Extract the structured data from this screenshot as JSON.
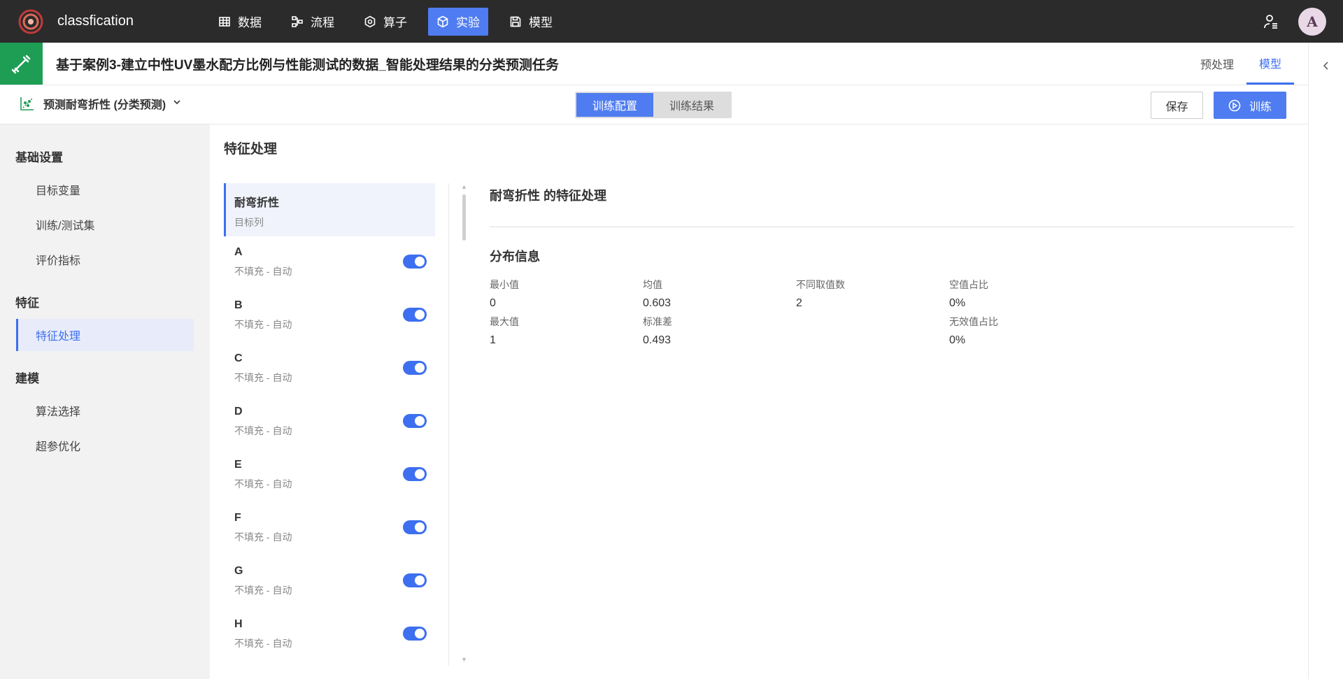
{
  "app": {
    "name": "classfication"
  },
  "nav": [
    {
      "label": "数据",
      "icon": "table-icon",
      "active": false
    },
    {
      "label": "流程",
      "icon": "flow-icon",
      "active": false
    },
    {
      "label": "算子",
      "icon": "hexagon-icon",
      "active": false
    },
    {
      "label": "实验",
      "icon": "cube-icon",
      "active": true
    },
    {
      "label": "模型",
      "icon": "save-icon",
      "active": false
    }
  ],
  "user": {
    "avatar_letter": "A"
  },
  "title": {
    "text": "基于案例3-建立中性UV墨水配方比例与性能测试的数据_智能处理结果的分类预测任务",
    "tabs": [
      {
        "label": "预处理",
        "active": false
      },
      {
        "label": "模型",
        "active": true
      }
    ]
  },
  "toolbar": {
    "task": "预测耐弯折性 (分类预测)",
    "segments": [
      {
        "label": "训练配置",
        "active": true
      },
      {
        "label": "训练结果",
        "active": false
      }
    ],
    "save_label": "保存",
    "train_label": "训练"
  },
  "sidebar": [
    {
      "group": "基础设置",
      "items": [
        {
          "label": "目标变量",
          "active": false
        },
        {
          "label": "训练/测试集",
          "active": false
        },
        {
          "label": "评价指标",
          "active": false
        }
      ]
    },
    {
      "group": "特征",
      "items": [
        {
          "label": "特征处理",
          "active": true
        }
      ]
    },
    {
      "group": "建模",
      "items": [
        {
          "label": "算法选择",
          "active": false
        },
        {
          "label": "超参优化",
          "active": false
        }
      ]
    }
  ],
  "section_title": "特征处理",
  "features": [
    {
      "name": "耐弯折性",
      "sub": "目标列",
      "selected": true,
      "toggle": null
    },
    {
      "name": "A",
      "sub": "不填充 - 自动",
      "selected": false,
      "toggle": true
    },
    {
      "name": "B",
      "sub": "不填充 - 自动",
      "selected": false,
      "toggle": true
    },
    {
      "name": "C",
      "sub": "不填充 - 自动",
      "selected": false,
      "toggle": true
    },
    {
      "name": "D",
      "sub": "不填充 - 自动",
      "selected": false,
      "toggle": true
    },
    {
      "name": "E",
      "sub": "不填充 - 自动",
      "selected": false,
      "toggle": true
    },
    {
      "name": "F",
      "sub": "不填充 - 自动",
      "selected": false,
      "toggle": true
    },
    {
      "name": "G",
      "sub": "不填充 - 自动",
      "selected": false,
      "toggle": true
    },
    {
      "name": "H",
      "sub": "不填充 - 自动",
      "selected": false,
      "toggle": true
    }
  ],
  "detail": {
    "title": "耐弯折性 的特征处理",
    "dist_title": "分布信息",
    "stats_row1": [
      {
        "label": "最小值",
        "value": "0"
      },
      {
        "label": "均值",
        "value": "0.603"
      },
      {
        "label": "不同取值数",
        "value": "2"
      },
      {
        "label": "空值占比",
        "value": "0%"
      }
    ],
    "stats_row2": [
      {
        "label": "最大值",
        "value": "1"
      },
      {
        "label": "标准差",
        "value": "0.493"
      },
      {
        "label": "",
        "value": ""
      },
      {
        "label": "无效值占比",
        "value": "0%"
      }
    ]
  }
}
